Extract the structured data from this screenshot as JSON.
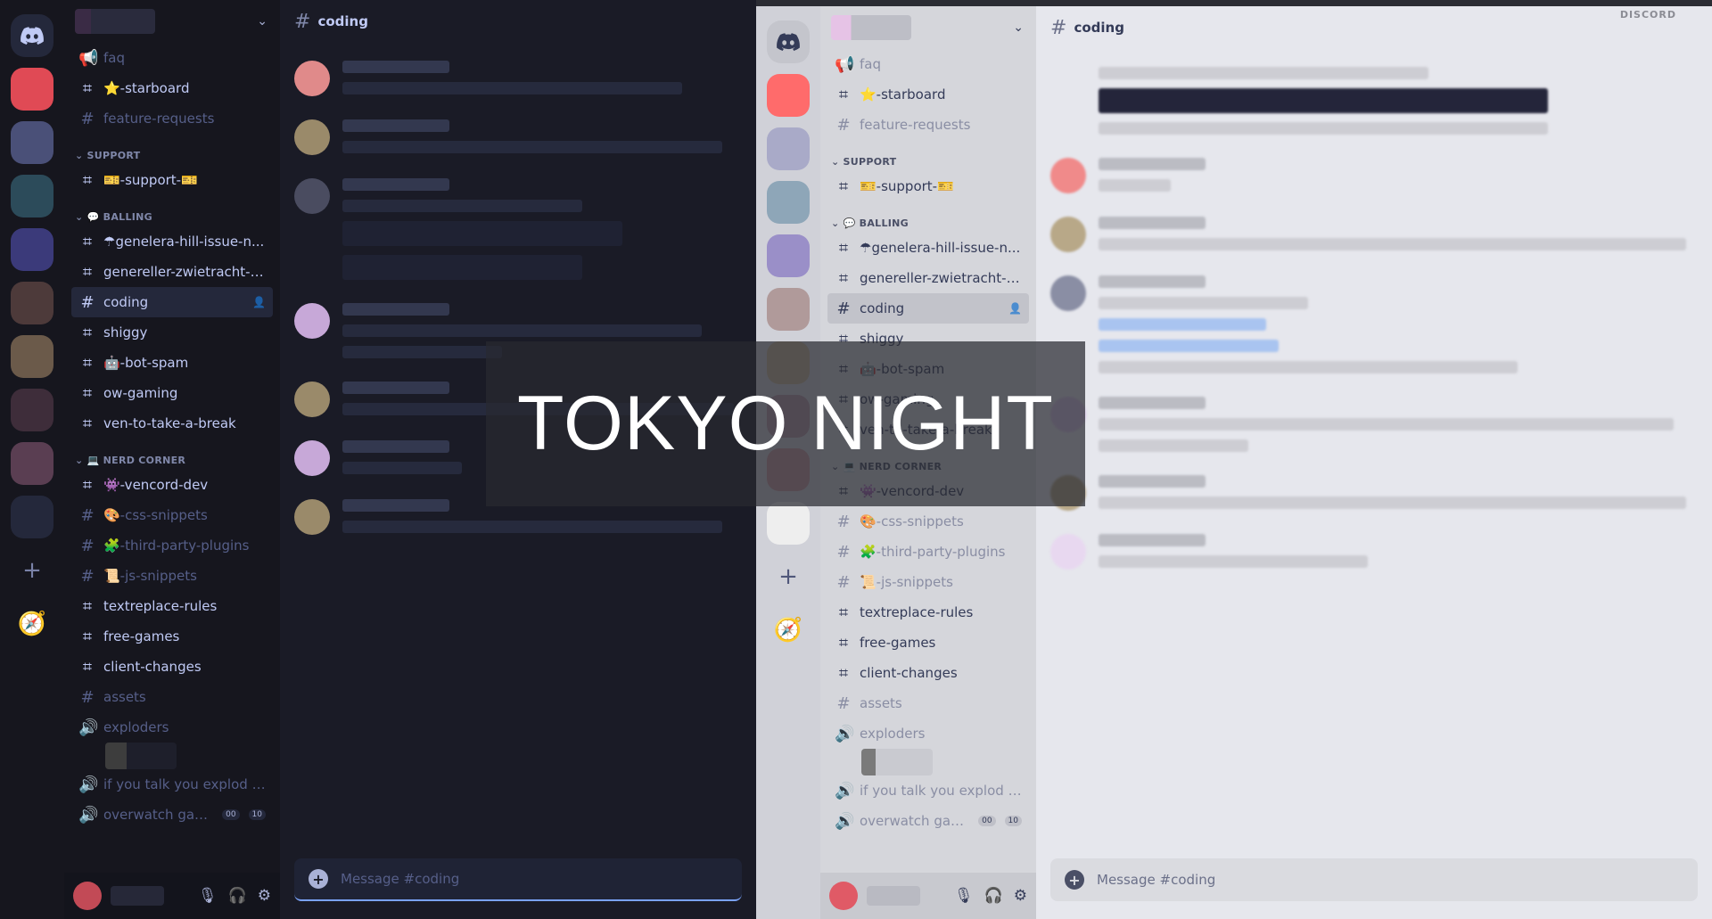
{
  "overlay": {
    "title": "TOKYO NIGHT"
  },
  "brand_word": "DISCORD",
  "colors": {
    "dark_bg": "#1a1b26",
    "light_bg": "#e6e7ed",
    "accent": "#7aa2f7"
  },
  "channels": [
    {
      "kind": "announce",
      "label": "faq",
      "muted": true
    },
    {
      "kind": "thread",
      "label": "⭐-starboard",
      "muted": false
    },
    {
      "kind": "text",
      "label": "feature-requests",
      "muted": true
    },
    {
      "kind": "category",
      "label": "SUPPORT"
    },
    {
      "kind": "thread",
      "label": "🎫-support-🎫",
      "muted": false
    },
    {
      "kind": "category",
      "label": "💬 BALLING"
    },
    {
      "kind": "thread",
      "label": "☂genelera-hill-issue-n...",
      "muted": false
    },
    {
      "kind": "thread",
      "label": "genereller-zwietracht-k...",
      "muted": false
    },
    {
      "kind": "text",
      "label": "coding",
      "muted": false,
      "active": true
    },
    {
      "kind": "thread",
      "label": "shiggy",
      "muted": false
    },
    {
      "kind": "thread",
      "label": "🤖-bot-spam",
      "muted": false
    },
    {
      "kind": "thread",
      "label": "ow-gaming",
      "muted": false
    },
    {
      "kind": "thread",
      "label": "ven-to-take-a-break",
      "muted": false
    },
    {
      "kind": "category",
      "label": "💻 NERD CORNER"
    },
    {
      "kind": "thread",
      "label": "👾-vencord-dev",
      "muted": false
    },
    {
      "kind": "text",
      "label": "🎨-css-snippets",
      "muted": true
    },
    {
      "kind": "text",
      "label": "🧩-third-party-plugins",
      "muted": true
    },
    {
      "kind": "text",
      "label": "📜-js-snippets",
      "muted": true
    },
    {
      "kind": "thread",
      "label": "textreplace-rules",
      "muted": false
    },
    {
      "kind": "thread",
      "label": "free-games",
      "muted": false
    },
    {
      "kind": "thread",
      "label": "client-changes",
      "muted": false
    },
    {
      "kind": "text",
      "label": "assets",
      "muted": true
    },
    {
      "kind": "voice",
      "label": "exploders",
      "muted": true
    },
    {
      "kind": "voice-user"
    },
    {
      "kind": "voice",
      "label": "if you talk you explod lik...",
      "muted": true
    },
    {
      "kind": "voice",
      "label": "overwatch gam...",
      "muted": true,
      "badges": [
        "00",
        "10"
      ]
    }
  ],
  "chat": {
    "channel_name": "coding",
    "composer_placeholder": "Message #coding"
  },
  "icons": {
    "discord": "discord-logo-icon",
    "add_server": "plus-icon",
    "explore": "compass-icon",
    "mute": "microphone-muted-icon",
    "deafen": "headphones-icon",
    "settings": "gear-icon"
  }
}
